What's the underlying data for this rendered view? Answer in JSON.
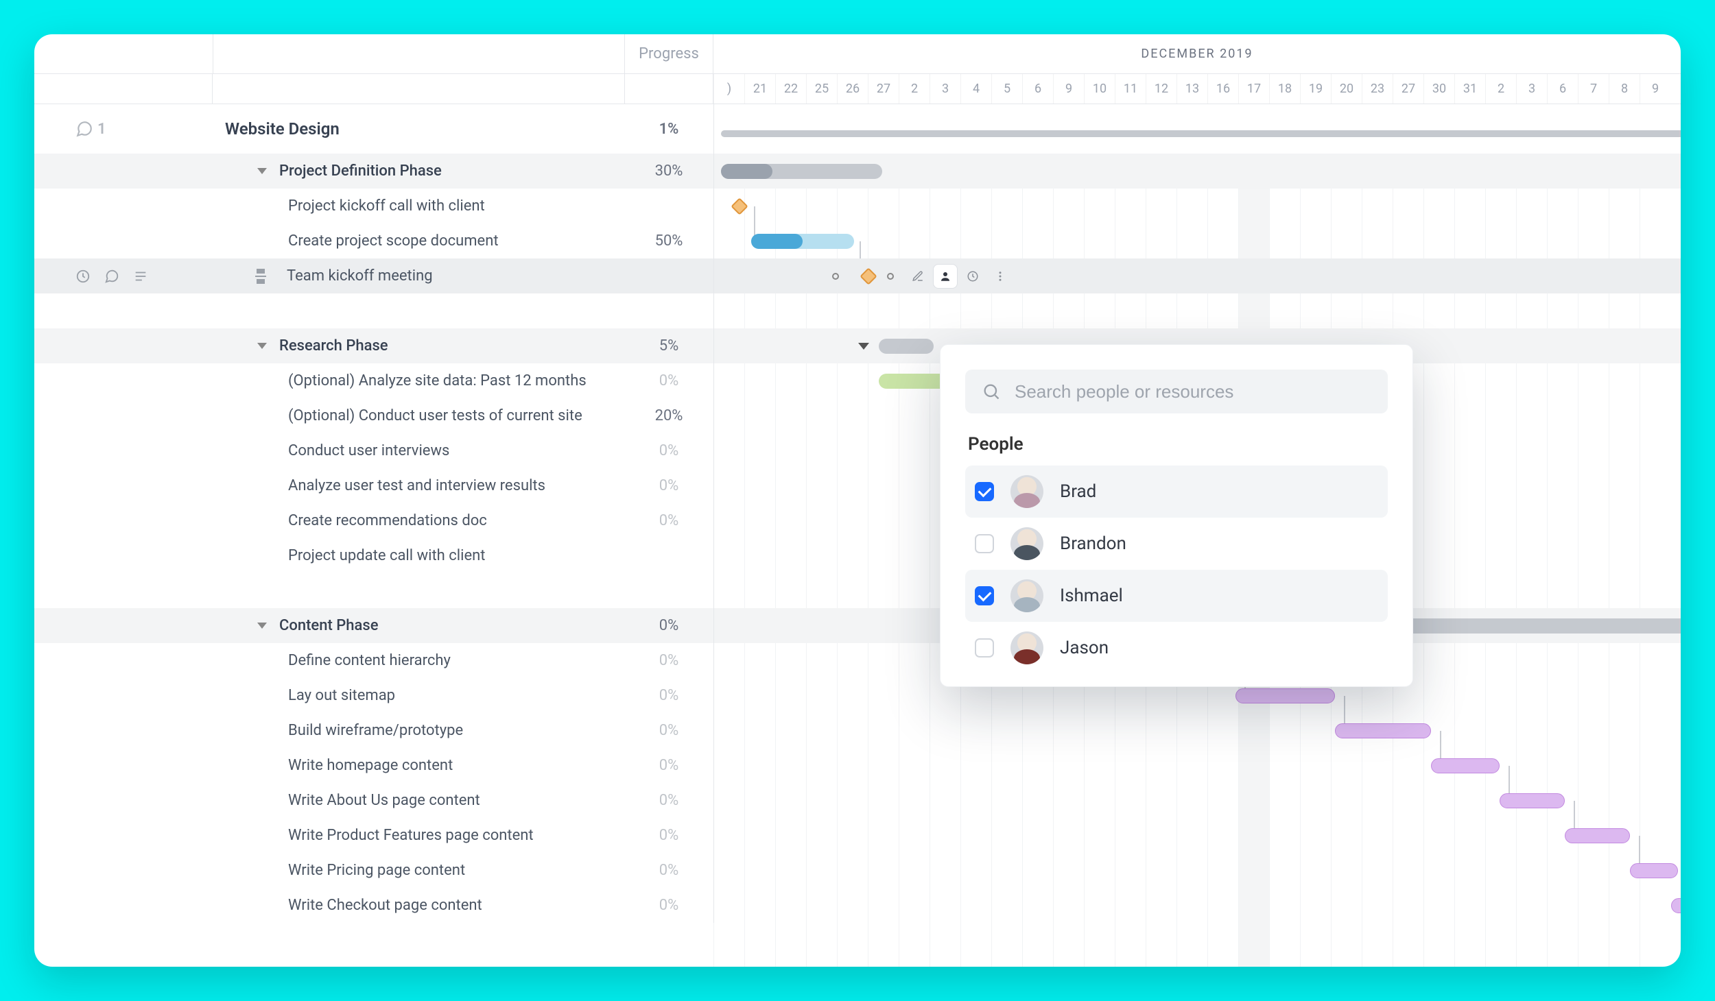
{
  "header": {
    "progress_label": "Progress",
    "month_label": "DECEMBER 2019"
  },
  "dates": [
    ")",
    "21",
    "22",
    "25",
    "26",
    "27",
    "2",
    "3",
    "4",
    "5",
    "6",
    "9",
    "10",
    "11",
    "12",
    "13",
    "16",
    "17",
    "18",
    "19",
    "20",
    "23",
    "27",
    "30",
    "31",
    "2",
    "3",
    "6",
    "7",
    "8",
    "9"
  ],
  "project": {
    "name": "Website Design",
    "progress": "1%",
    "comment_count": "1"
  },
  "phases": [
    {
      "name": "Project Definition Phase",
      "progress": "30%",
      "tasks": [
        {
          "name": "Project kickoff call with client",
          "progress": "",
          "checkbox": true
        },
        {
          "name": "Create project scope document",
          "progress": "50%"
        },
        {
          "name": "Team kickoff meeting",
          "progress": "",
          "checkbox": true,
          "selected": true
        }
      ]
    },
    {
      "name": "Research Phase",
      "progress": "5%",
      "tasks": [
        {
          "name": "(Optional) Analyze site data: Past 12 months",
          "progress": "0%"
        },
        {
          "name": "(Optional) Conduct user tests of current site",
          "progress": "20%"
        },
        {
          "name": "Conduct user interviews",
          "progress": "0%"
        },
        {
          "name": "Analyze user test and interview results",
          "progress": "0%"
        },
        {
          "name": "Create recommendations doc",
          "progress": "0%"
        },
        {
          "name": "Project update call with client",
          "progress": "",
          "checkbox": true
        }
      ]
    },
    {
      "name": "Content Phase",
      "progress": "0%",
      "tasks": [
        {
          "name": "Define content hierarchy",
          "progress": "0%"
        },
        {
          "name": "Lay out sitemap",
          "progress": "0%"
        },
        {
          "name": "Build wireframe/prototype",
          "progress": "0%"
        },
        {
          "name": "Write homepage content",
          "progress": "0%"
        },
        {
          "name": "Write About Us page content",
          "progress": "0%"
        },
        {
          "name": "Write Product Features page content",
          "progress": "0%"
        },
        {
          "name": "Write Pricing page content",
          "progress": "0%"
        },
        {
          "name": "Write Checkout page content",
          "progress": "0%"
        }
      ]
    }
  ],
  "popover": {
    "search_placeholder": "Search people or resources",
    "section_title": "People",
    "people": [
      {
        "name": "Brad",
        "checked": true
      },
      {
        "name": "Brandon",
        "checked": false
      },
      {
        "name": "Ishmael",
        "checked": true
      },
      {
        "name": "Jason",
        "checked": false
      }
    ]
  },
  "colors": {
    "accent_blue": "#1769ff",
    "bar_gray": "#c5c9cf",
    "bar_blue": "#b6dff0",
    "bar_green": "#c9e4a6",
    "bar_purple": "#dcb8f0",
    "milestone": "#f5c07a"
  }
}
